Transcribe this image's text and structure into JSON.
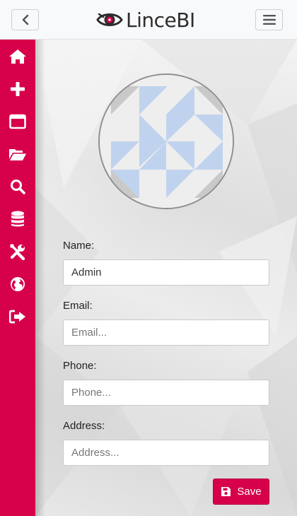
{
  "header": {
    "brand": "LinceBI",
    "back_icon": "chevron-left-icon",
    "menu_icon": "hamburger-icon"
  },
  "sidebar": {
    "items": [
      {
        "icon": "home-icon"
      },
      {
        "icon": "plus-icon"
      },
      {
        "icon": "window-icon"
      },
      {
        "icon": "folder-open-icon"
      },
      {
        "icon": "search-icon"
      },
      {
        "icon": "database-icon"
      },
      {
        "icon": "tools-icon"
      },
      {
        "icon": "globe-icon"
      },
      {
        "icon": "sign-out-icon"
      }
    ]
  },
  "form": {
    "name_label": "Name:",
    "name_value": "Admin",
    "email_label": "Email:",
    "email_placeholder": "Email...",
    "phone_label": "Phone:",
    "phone_placeholder": "Phone...",
    "address_label": "Address:",
    "address_placeholder": "Address...",
    "save_label": "Save"
  },
  "colors": {
    "accent": "#d7004b",
    "identicon": "#c0d3ee"
  }
}
